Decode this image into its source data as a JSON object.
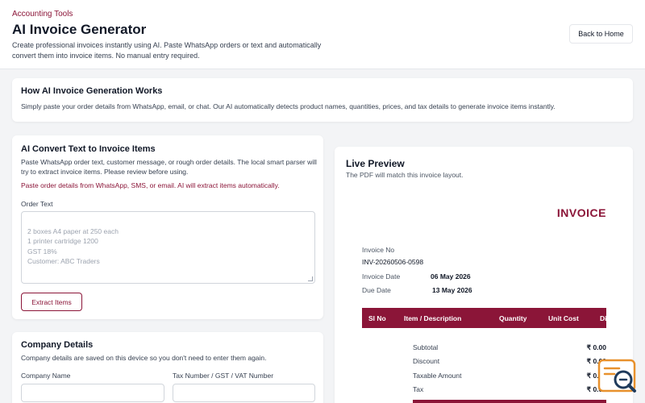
{
  "header": {
    "breadcrumb": "Accounting Tools",
    "title": "AI Invoice Generator",
    "description": "Create professional invoices instantly using AI. Paste WhatsApp orders or text and automatically convert them into invoice items. No manual entry required.",
    "back_label": "Back to Home"
  },
  "how": {
    "title": "How AI Invoice Generation Works",
    "text": "Simply paste your order details from WhatsApp, email, or chat. Our AI automatically detects product names, quantities, prices, and tax details to generate invoice items instantly."
  },
  "ai_convert": {
    "title": "AI Convert Text to Invoice Items",
    "description": "Paste WhatsApp order text, customer message, or rough order details. The local smart parser will try to extract invoice items. Please review before using.",
    "hint": "Paste order details from WhatsApp, SMS, or email. AI will extract items automatically.",
    "order_label": "Order Text",
    "placeholder": "2 boxes A4 paper at 250 each\n1 printer cartridge 1200\nGST 18%\nCustomer: ABC Traders",
    "extract_label": "Extract Items"
  },
  "company": {
    "title": "Company Details",
    "description": "Company details are saved on this device so you don't need to enter them again.",
    "name_label": "Company Name",
    "tax_label": "Tax Number / GST / VAT Number",
    "name_value": "",
    "tax_value": ""
  },
  "preview": {
    "title": "Live Preview",
    "subtitle": "The PDF will match this invoice layout.",
    "heading": "INVOICE",
    "invoice_no_label": "Invoice No",
    "invoice_no": "INV-20260506-0598",
    "invoice_date_label": "Invoice Date",
    "invoice_date": "06 May 2026",
    "due_date_label": "Due Date",
    "due_date": "13 May 2026",
    "columns": [
      "Sl No",
      "Item / Description",
      "Quantity",
      "Unit Cost",
      "Di"
    ],
    "summary": [
      {
        "label": "Subtotal",
        "value": "₹ 0.00"
      },
      {
        "label": "Discount",
        "value": "₹ 0.00"
      },
      {
        "label": "Taxable Amount",
        "value": "₹ 0.00"
      },
      {
        "label": "Tax",
        "value": "₹ 0.00"
      }
    ]
  },
  "colors": {
    "accent": "#8b1538",
    "widget": "#e8912d"
  },
  "icons": {
    "resize": "resize-handle-icon",
    "chat": "chat-search-icon"
  }
}
